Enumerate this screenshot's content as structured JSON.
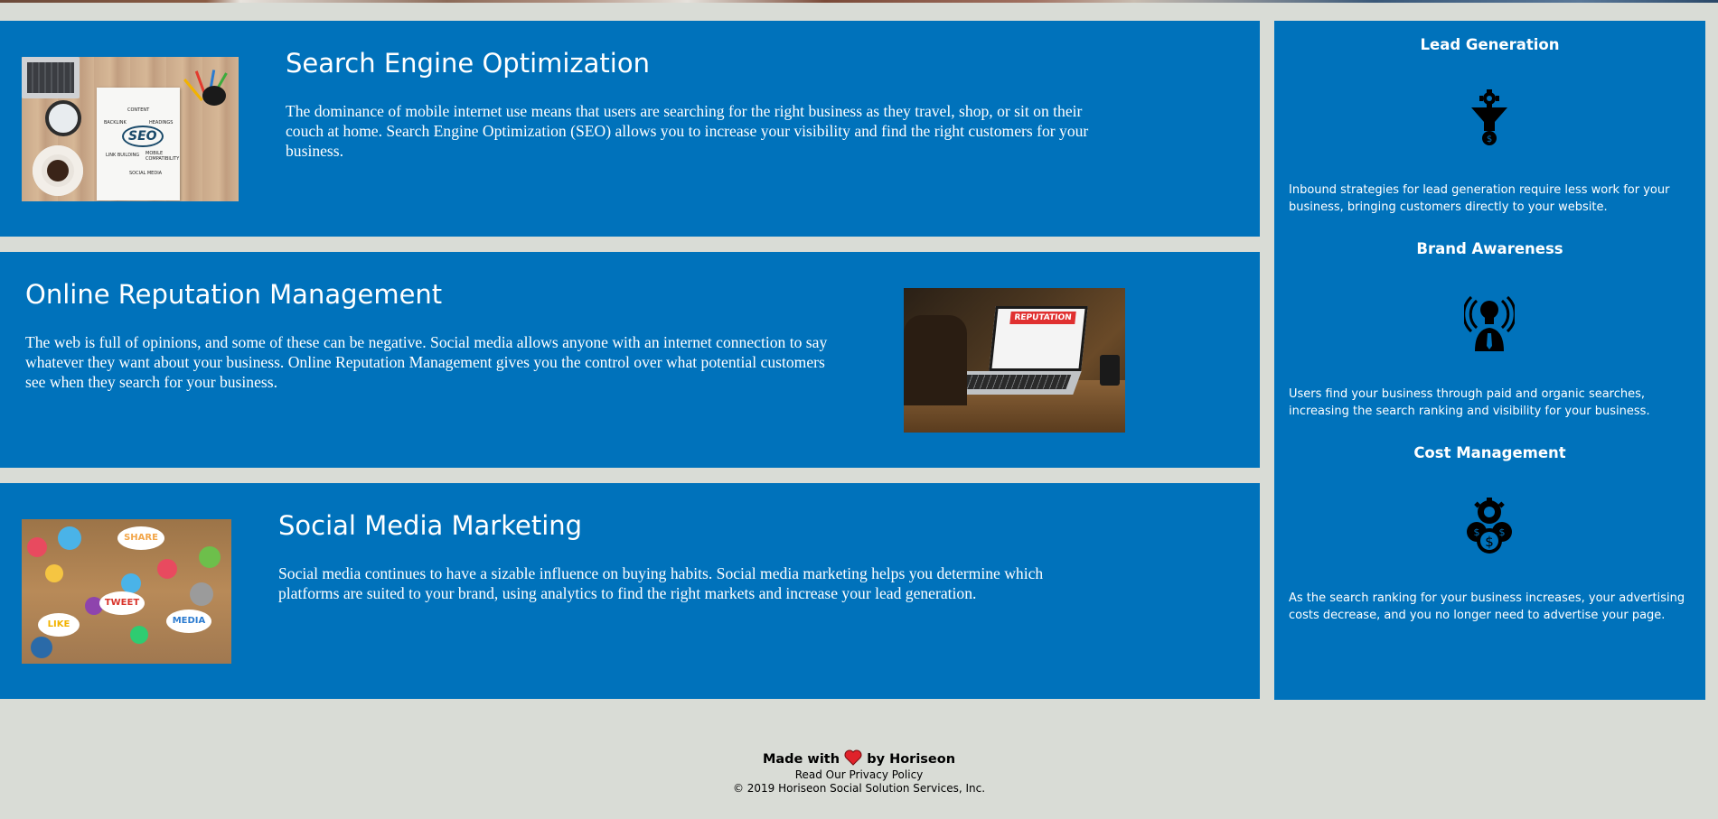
{
  "services": [
    {
      "title": "Search Engine Optimization",
      "text": "The dominance of mobile internet use means that users are searching for the right business as they travel, shop, or sit on their couch at home. Search Engine Optimization (SEO) allows you to increase your visibility and find the right customers for your business.",
      "image_label": "SEO",
      "image_words": [
        "CONTENT",
        "BACKLINK",
        "HEADINGS",
        "LINK BUILDING",
        "MOBILE COMPATIBILITY",
        "SOCIAL MEDIA"
      ]
    },
    {
      "title": "Online Reputation Management",
      "text": "The web is full of opinions, and some of these can be negative. Social media allows anyone with an internet connection to say whatever they want about your business. Online Reputation Management gives you the control over what potential customers see when they search for your business.",
      "image_label": "REPUTATION"
    },
    {
      "title": "Social Media Marketing",
      "text": "Social media continues to have a sizable influence on buying habits. Social media marketing helps you determine which platforms are suited to your brand, using analytics to find the right markets and increase your lead generation.",
      "image_words": [
        "SHARE",
        "TWEET",
        "LIKE",
        "MEDIA"
      ]
    }
  ],
  "benefits": [
    {
      "title": "Lead Generation",
      "icon": "lead-generation-icon",
      "text": "Inbound strategies for lead generation require less work for your business, bringing customers directly to your website."
    },
    {
      "title": "Brand Awareness",
      "icon": "brand-awareness-icon",
      "text": "Users find your business through paid and organic searches, increasing the search ranking and visibility for your business."
    },
    {
      "title": "Cost Management",
      "icon": "cost-management-icon",
      "text": "As the search ranking for your business increases, your advertising costs decrease, and you no longer need to advertise your page."
    }
  ],
  "footer": {
    "made_prefix": "Made with",
    "made_suffix": "by Horiseon",
    "privacy": "Read Our Privacy Policy",
    "copyright": "© 2019 Horiseon Social Solution Services, Inc."
  },
  "colors": {
    "card": "#0072bb",
    "page_bg": "#d9dcd6",
    "heart": "#e0222a"
  }
}
